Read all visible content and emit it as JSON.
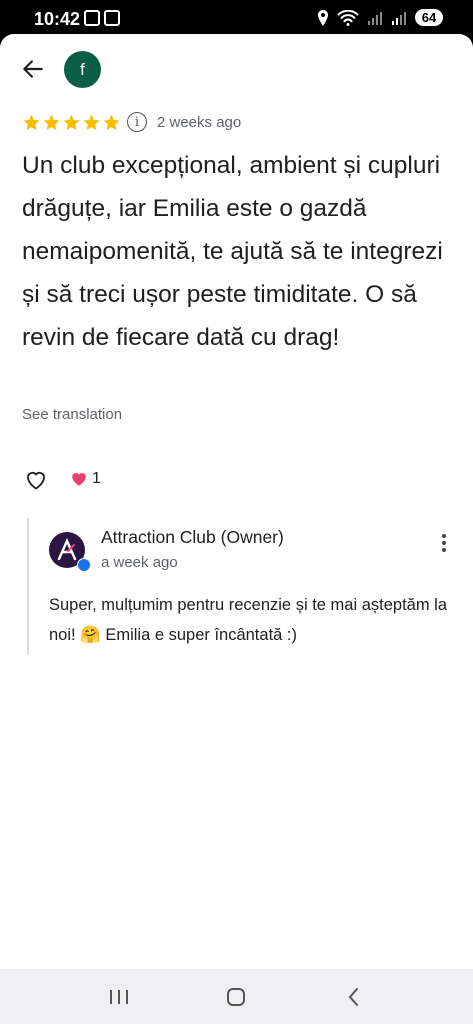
{
  "status_bar": {
    "time": "10:42",
    "battery": "64"
  },
  "header": {
    "avatar_letter": "f",
    "avatar_color": "#0b5e46"
  },
  "review": {
    "rating": 5,
    "max_rating": 5,
    "star_color": "#fbbc04",
    "date": "2 weeks ago",
    "text": "Un club excepțional, ambient și cupluri drăguțe, iar Emilia este o gazdă nemaipomenită, te ajută să te integrezi și să treci ușor peste timiditate. O să revin de fiecare dată cu drag!",
    "see_translation": "See translation",
    "reaction_count": "1"
  },
  "owner_reply": {
    "name": "Attraction Club (Owner)",
    "date": "a week ago",
    "text": "Super, mulțumim pentru recenzie și te mai așteptăm la noi! 🤗 Emilia e super încântată :)"
  },
  "icons": {
    "back": "arrow-left-icon",
    "info": "info-icon",
    "like": "heart-outline-icon",
    "reaction": "heart-filled-icon",
    "more": "more-vertical-icon",
    "nav_recent": "recent-apps-icon",
    "nav_home": "home-icon",
    "nav_back": "chevron-left-icon"
  }
}
